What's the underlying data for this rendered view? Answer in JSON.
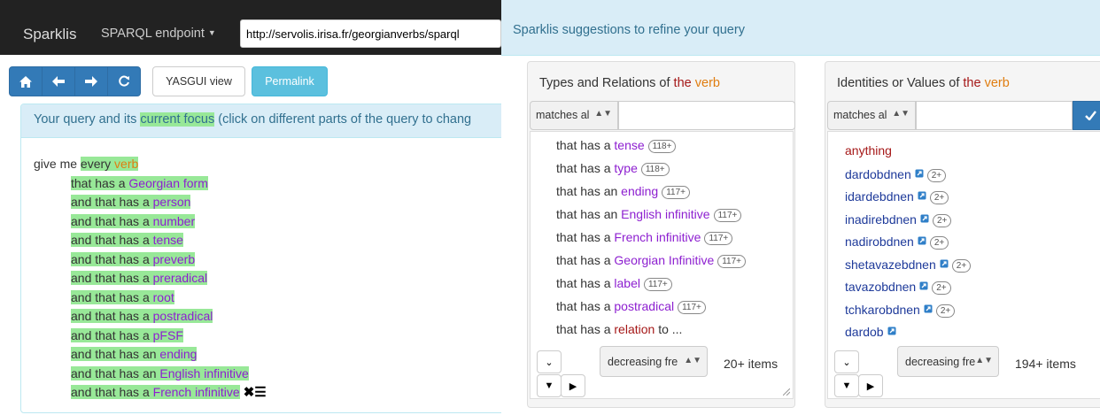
{
  "navbar": {
    "brand": "Sparklis",
    "endpoint_label": "SPARQL endpoint",
    "endpoint_url": "http://servolis.irisa.fr/georgianverbs/sparql"
  },
  "toolbar": {
    "home_icon": "home-icon",
    "back_icon": "arrow-left-icon",
    "forward_icon": "arrow-right-icon",
    "refresh_icon": "refresh-icon",
    "yasgui_label": "YASGUI view",
    "permalink_label": "Permalink",
    "accent": "#337ab7",
    "info": "#5bc0de"
  },
  "query": {
    "heading_pre": "Your query and its ",
    "heading_focus": "current focus",
    "heading_post": " (click on different parts of the query to chang",
    "give_me": "give me ",
    "every": "every",
    "verb": "verb",
    "lines": [
      {
        "pre": "that has a ",
        "term": "Georgian form"
      },
      {
        "pre": "and that has a ",
        "term": "person"
      },
      {
        "pre": "and that has a ",
        "term": "number"
      },
      {
        "pre": "and that has a ",
        "term": "tense"
      },
      {
        "pre": "and that has a ",
        "term": "preverb"
      },
      {
        "pre": "and that has a ",
        "term": "preradical"
      },
      {
        "pre": "and that has a ",
        "term": "root"
      },
      {
        "pre": "and that has a ",
        "term": "postradical"
      },
      {
        "pre": "and that has a ",
        "term": "pFSF"
      },
      {
        "pre": "and that has an ",
        "term": "ending"
      },
      {
        "pre": "and that has an ",
        "term": "English infinitive"
      },
      {
        "pre": "and that has a ",
        "term": "French infinitive"
      }
    ],
    "focus_tools": "✖☰",
    "focus_color": "#98e898"
  },
  "suggestions": {
    "heading": "Sparklis suggestions to refine your query",
    "types": {
      "title_pre": "Types and Relations of ",
      "title_the": "the",
      "title_verb": "verb",
      "match_label": "matches al",
      "filter_value": "",
      "items": [
        {
          "pre": "that has a ",
          "term": "tense",
          "post": "",
          "count": "118+"
        },
        {
          "pre": "that has a ",
          "term": "type",
          "post": "",
          "count": "118+"
        },
        {
          "pre": "that has an ",
          "term": "ending",
          "post": "",
          "count": "117+"
        },
        {
          "pre": "that has an ",
          "term": "English infinitive",
          "post": "",
          "count": "117+"
        },
        {
          "pre": "that has a ",
          "term": "French infinitive",
          "post": "",
          "count": "117+"
        },
        {
          "pre": "that has a ",
          "term": "Georgian Infinitive",
          "post": "",
          "count": "117+"
        },
        {
          "pre": "that has a ",
          "term": "label",
          "post": "",
          "count": "117+"
        },
        {
          "pre": "that has a ",
          "term": "postradical",
          "post": "",
          "count": "117+"
        },
        {
          "pre": "that has a ",
          "term": "relation",
          "post": " to ...",
          "count": ""
        }
      ],
      "sort_label": "decreasing fre",
      "item_count": "20+ items"
    },
    "identities": {
      "title_pre": "Identities or Values of ",
      "title_the": "the",
      "title_verb": "verb",
      "match_label": "matches al",
      "filter_value": "",
      "anything": "anything",
      "items": [
        {
          "label": "dardobdnen",
          "count": "2+"
        },
        {
          "label": "idardebdnen",
          "count": "2+"
        },
        {
          "label": "inadirebdnen",
          "count": "2+"
        },
        {
          "label": "nadirobdnen",
          "count": "2+"
        },
        {
          "label": "shetavazebdnen",
          "count": "2+"
        },
        {
          "label": "tavazobdnen",
          "count": "2+"
        },
        {
          "label": "tchkarobdnen",
          "count": "2+"
        },
        {
          "label": "dardob",
          "count": ""
        }
      ],
      "sort_label": "decreasing fre",
      "item_count": "194+ items"
    }
  }
}
